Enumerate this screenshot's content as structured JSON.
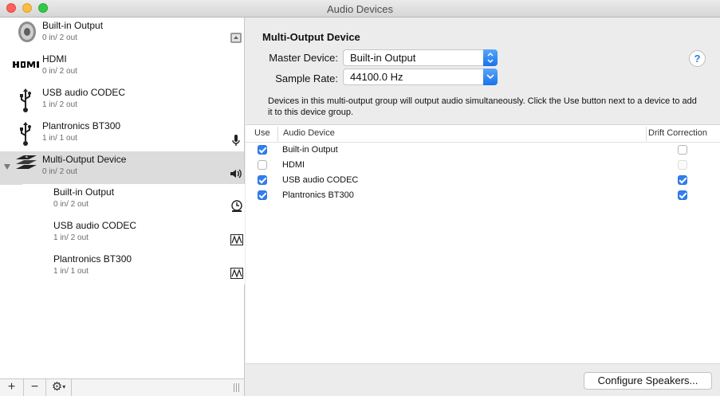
{
  "window": {
    "title": "Audio Devices"
  },
  "sidebar": {
    "devices": [
      {
        "name": "Built-in Output",
        "io": "0 in/ 2 out",
        "icon": "speaker-icon",
        "right_icon": "finder-icon"
      },
      {
        "name": "HDMI",
        "io": "0 in/ 2 out",
        "icon": "hdmi-logo"
      },
      {
        "name": "USB audio CODEC",
        "io": "1 in/ 2 out",
        "icon": "usb-icon"
      },
      {
        "name": "Plantronics BT300",
        "io": "1 in/ 1 out",
        "icon": "usb-icon",
        "right_icon": "microphone-icon"
      },
      {
        "name": "Multi-Output Device",
        "io": "0 in/ 2 out",
        "icon": "multi-output-icon",
        "right_icon": "speaker-volume-icon",
        "selected": true,
        "expanded": true
      }
    ],
    "subdevices": [
      {
        "name": "Built-in Output",
        "io": "0 in/ 2 out",
        "right_icon": "clock-icon"
      },
      {
        "name": "USB audio CODEC",
        "io": "1 in/ 2 out",
        "right_icon": "waveform-icon"
      },
      {
        "name": "Plantronics BT300",
        "io": "1 in/ 1 out",
        "right_icon": "waveform-icon"
      }
    ],
    "toolbar": {
      "add": "+",
      "remove": "−",
      "gear": "⚙"
    }
  },
  "detail": {
    "heading": "Multi-Output Device",
    "master_label": "Master Device:",
    "master_value": "Built-in Output",
    "rate_label": "Sample Rate:",
    "rate_value": "44100.0 Hz",
    "help": "?",
    "description": "Devices in this multi-output group will output audio simultaneously. Click the Use button next to a device to add it to this device group.",
    "table": {
      "headers": {
        "use": "Use",
        "device": "Audio Device",
        "drift": "Drift Correction"
      },
      "rows": [
        {
          "use": true,
          "device": "Built-in Output",
          "drift": false,
          "drift_enabled": true
        },
        {
          "use": false,
          "device": "HDMI",
          "drift": false,
          "drift_enabled": false
        },
        {
          "use": true,
          "device": "USB audio CODEC",
          "drift": true,
          "drift_enabled": true
        },
        {
          "use": true,
          "device": "Plantronics BT300",
          "drift": true,
          "drift_enabled": true
        }
      ]
    },
    "configure_button": "Configure Speakers..."
  },
  "colors": {
    "accent": "#2f7ff1",
    "selection": "#dcdcdc"
  }
}
